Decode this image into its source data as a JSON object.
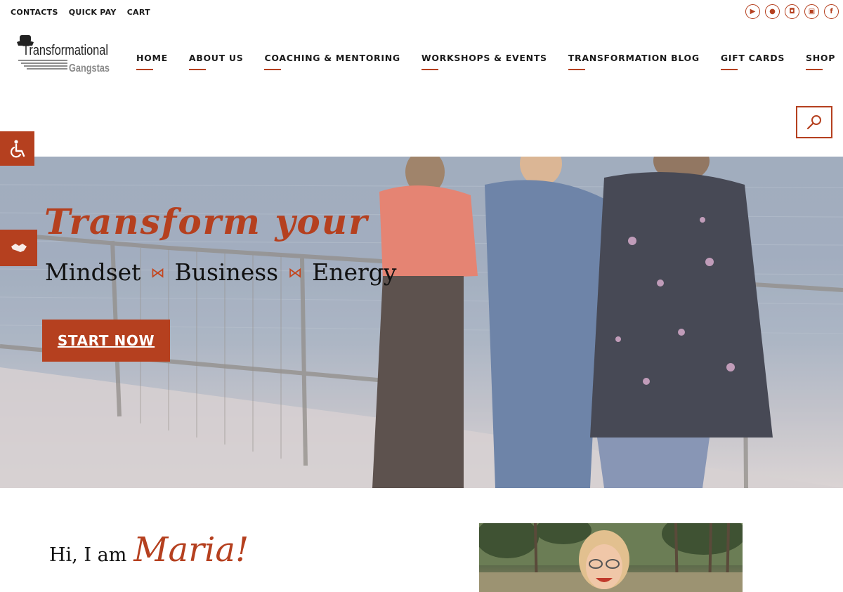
{
  "top_links": [
    "CONTACTS",
    "QUICK PAY",
    "CART"
  ],
  "social_icons": [
    "youtube-icon",
    "apple-icon",
    "instagram-icon",
    "youtube-tv-icon",
    "facebook-icon"
  ],
  "logo": {
    "line1": "Transformational",
    "line2": "Gangstas"
  },
  "nav": [
    "HOME",
    "ABOUT US",
    "COACHING & MENTORING",
    "WORKSHOPS & EVENTS",
    "TRANSFORMATION BLOG",
    "GIFT CARDS",
    "SHOP"
  ],
  "hero": {
    "title": "Transform your",
    "words": [
      "Mindset",
      "Business",
      "Energy"
    ],
    "button": "START NOW"
  },
  "about": {
    "greeting": "Hi, I am",
    "name": "Maria!"
  },
  "colors": {
    "accent": "#b5401f",
    "text": "#1a1a1a"
  }
}
